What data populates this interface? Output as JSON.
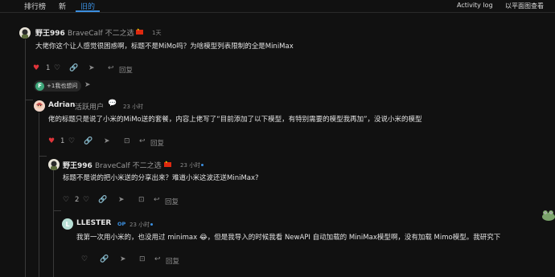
{
  "nav": {
    "tabs": [
      {
        "label": "排行榜"
      },
      {
        "label": "新"
      },
      {
        "label": "旧的"
      }
    ],
    "activity_log": "Activity log",
    "view_plain": "以平面图查看"
  },
  "posts": [
    {
      "username": "野王996",
      "flair": "BraveCalf  不二之选",
      "time": "1天",
      "text": "大佬你这个让人感觉很困惑啊，标题不是MiMo吗？为啥模型列表限制的全是MiniMax",
      "likes": "1",
      "reply_label": "回复",
      "reaction_pill": {
        "avatar_letter": "F",
        "text": "+1我也想问"
      }
    },
    {
      "username": "Adrian",
      "flair": "活跃用户",
      "time": "23 小时",
      "text": "佬的标题只是说了小米的MiMo送的套餐，内容上佬写了“目前添加了以下模型，有特别需要的模型我再加”，没说小米的模型",
      "likes": "1",
      "reply_label": "回复"
    },
    {
      "username": "野王996",
      "flair": "BraveCalf  不二之选",
      "time": "23 小时",
      "text": "标题不是说的把小米送的分享出来？难道小米这波还送MiniMax?",
      "likes": "2",
      "reply_label": "回复"
    },
    {
      "username": "LLESTER",
      "badge": "OP",
      "time": "23 小时",
      "text": "我第一次用小米的，也没用过 minimax 😂，但是我导入的时候我看 NewAPI 自动加载的 MiniMax模型啊，没有加载 Mimo模型。我研究下",
      "reply_label": "回复"
    }
  ],
  "colors": {
    "accent": "#3b8fe0",
    "heart": "#e0353b",
    "background": "#111111"
  },
  "icons": {
    "heart": "♥",
    "heart_outline": "♡",
    "share": "➤",
    "link": "🔗",
    "reply": "↩",
    "bookmark": "⊡"
  }
}
